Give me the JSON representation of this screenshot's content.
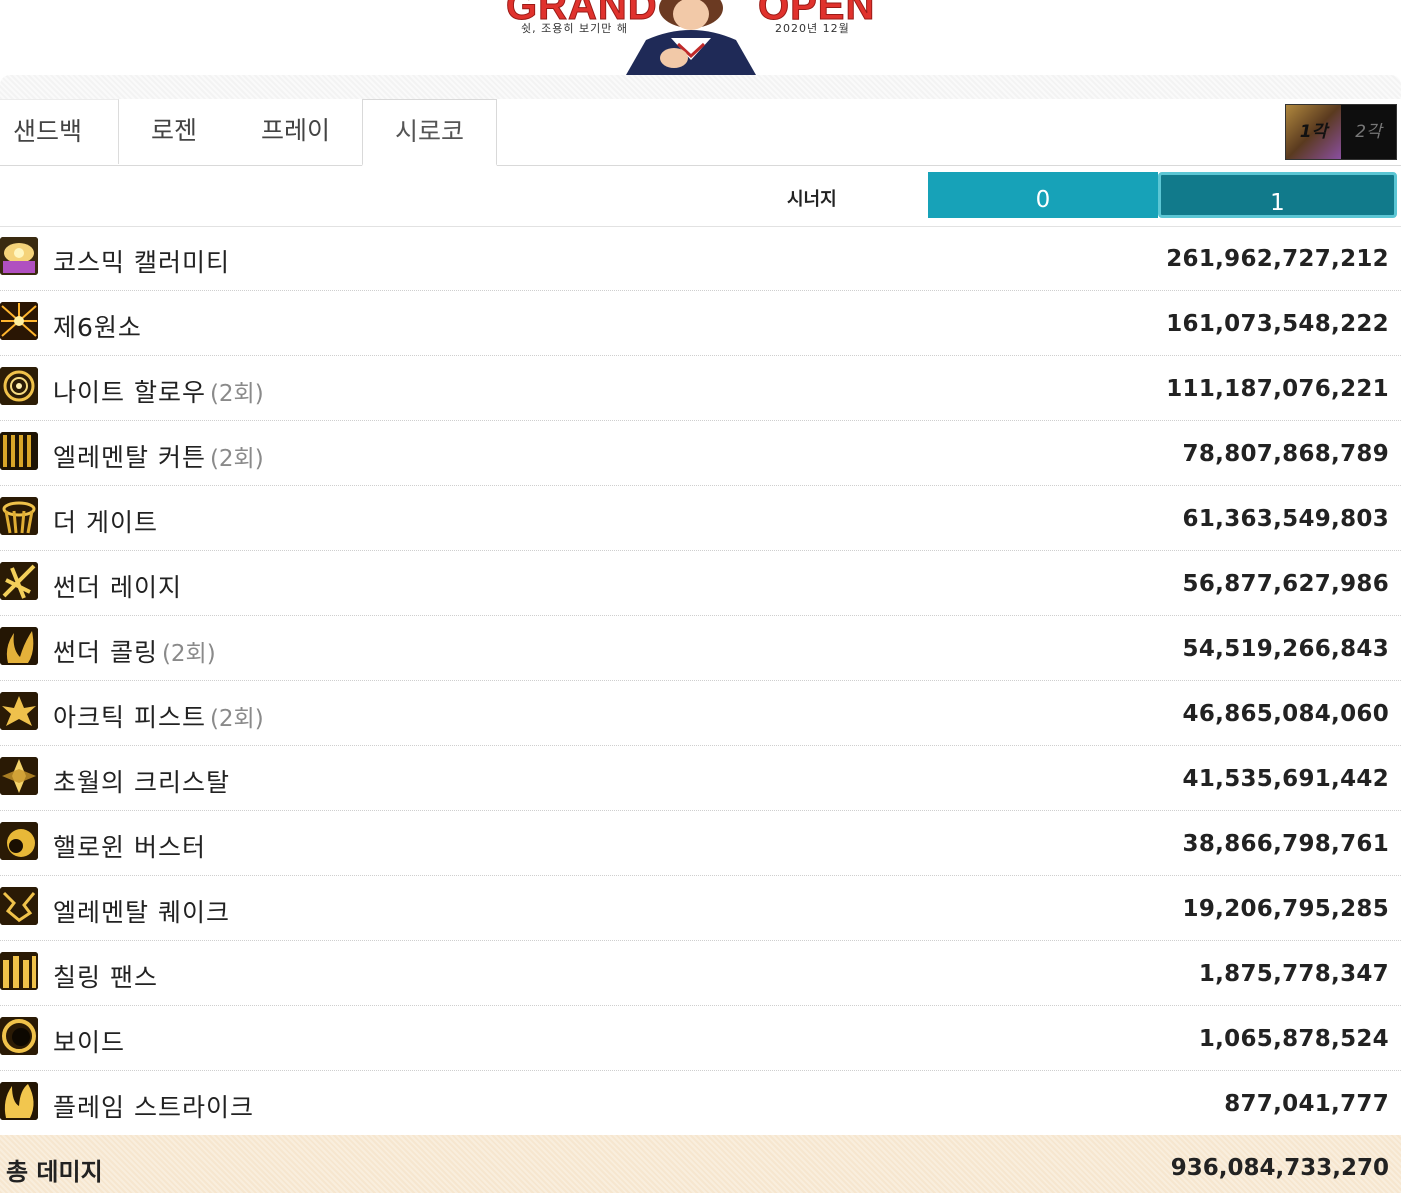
{
  "banner": {
    "title_left": "GRAND",
    "title_right": "OPEN",
    "subtitle_left": "쉿, 조용히 보기만 해",
    "subtitle_right": "2020년 12월"
  },
  "tabs": [
    {
      "label": "샌드백"
    },
    {
      "label": "로젠"
    },
    {
      "label": "프레이"
    },
    {
      "label": "시로코",
      "active": true
    }
  ],
  "core_toggle": {
    "left": "1각",
    "right": "2각",
    "selected": "1각"
  },
  "synergy": {
    "label": "시너지",
    "options": [
      "0",
      "1"
    ],
    "selected": "1"
  },
  "skills": [
    {
      "name": "코스믹 캘러미티",
      "count": "",
      "value": "261,962,727,212",
      "icon": "cosmic-calamity-icon"
    },
    {
      "name": "제6원소",
      "count": "",
      "value": "161,073,548,222",
      "icon": "sixth-element-icon"
    },
    {
      "name": "나이트 할로우",
      "count": "(2회)",
      "value": "111,187,076,221",
      "icon": "night-hollow-icon"
    },
    {
      "name": "엘레멘탈 커튼",
      "count": "(2회)",
      "value": "78,807,868,789",
      "icon": "elemental-curtain-icon"
    },
    {
      "name": "더 게이트",
      "count": "",
      "value": "61,363,549,803",
      "icon": "the-gate-icon"
    },
    {
      "name": "썬더 레이지",
      "count": "",
      "value": "56,877,627,986",
      "icon": "thunder-rage-icon"
    },
    {
      "name": "썬더 콜링",
      "count": "(2회)",
      "value": "54,519,266,843",
      "icon": "thunder-calling-icon"
    },
    {
      "name": "아크틱 피스트",
      "count": "(2회)",
      "value": "46,865,084,060",
      "icon": "arctic-fist-icon"
    },
    {
      "name": "초월의 크리스탈",
      "count": "",
      "value": "41,535,691,442",
      "icon": "crystal-icon"
    },
    {
      "name": "핼로윈 버스터",
      "count": "",
      "value": "38,866,798,761",
      "icon": "halloween-buster-icon"
    },
    {
      "name": "엘레멘탈 퀘이크",
      "count": "",
      "value": "19,206,795,285",
      "icon": "elemental-quake-icon"
    },
    {
      "name": "칠링 팬스",
      "count": "",
      "value": "1,875,778,347",
      "icon": "chilling-fence-icon"
    },
    {
      "name": "보이드",
      "count": "",
      "value": "1,065,878,524",
      "icon": "void-icon"
    },
    {
      "name": "플레임 스트라이크",
      "count": "",
      "value": "877,041,777",
      "icon": "flame-strike-icon"
    }
  ],
  "total": {
    "label": "총 데미지",
    "value": "936,084,733,270"
  },
  "colors": {
    "synergy_off": "#17a2b8",
    "synergy_on": "#117a8b",
    "total_bg": "#f6e6cf",
    "icon_gold": "#e6b422"
  }
}
